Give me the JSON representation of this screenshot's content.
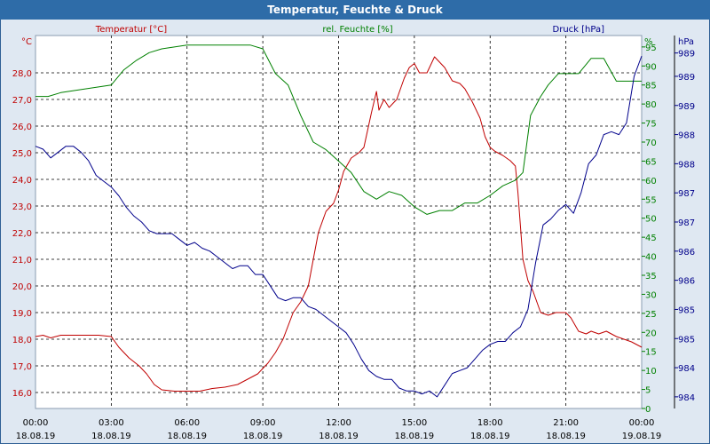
{
  "window": {
    "title": "Temperatur, Feuchte & Druck"
  },
  "chart_data": {
    "type": "line",
    "title": "Temperatur, Feuchte & Druck",
    "x_ticks": [
      {
        "time": "00:00",
        "date": "18.08.19"
      },
      {
        "time": "03:00",
        "date": "18.08.19"
      },
      {
        "time": "06:00",
        "date": "18.08.19"
      },
      {
        "time": "09:00",
        "date": "18.08.19"
      },
      {
        "time": "12:00",
        "date": "18.08.19"
      },
      {
        "time": "15:00",
        "date": "18.08.19"
      },
      {
        "time": "18:00",
        "date": "18.08.19"
      },
      {
        "time": "21:00",
        "date": "18.08.19"
      },
      {
        "time": "00:00",
        "date": "19.08.19"
      }
    ],
    "xlim_hours": [
      0,
      24
    ],
    "grid": true,
    "axes": {
      "temp": {
        "label": "Temperatur [°C]",
        "unit": "°C",
        "color": "#c00000",
        "ylim": [
          15.4,
          29.4
        ],
        "ticks": [
          "16,0",
          "17,0",
          "18,0",
          "19,0",
          "20,0",
          "21,0",
          "22,0",
          "23,0",
          "24,0",
          "25,0",
          "26,0",
          "27,0",
          "28,0"
        ],
        "tick_values": [
          16,
          17,
          18,
          19,
          20,
          21,
          22,
          23,
          24,
          25,
          26,
          27,
          28
        ]
      },
      "humidity": {
        "label": "rel. Feuchte [%]",
        "unit": "%",
        "color": "#008000",
        "ylim": [
          0,
          98
        ],
        "ticks": [
          "0",
          "5",
          "10",
          "15",
          "20",
          "25",
          "30",
          "35",
          "40",
          "45",
          "50",
          "55",
          "60",
          "65",
          "70",
          "75",
          "80",
          "85",
          "90",
          "95"
        ],
        "tick_values": [
          0,
          5,
          10,
          15,
          20,
          25,
          30,
          35,
          40,
          45,
          50,
          55,
          60,
          65,
          70,
          75,
          80,
          85,
          90,
          95
        ]
      },
      "pressure": {
        "label": "Druck [hPa]",
        "unit": "hPa",
        "color": "#00008b",
        "ylim": [
          983.5,
          989.9
        ],
        "ticks": [
          "984",
          "984",
          "985",
          "985",
          "986",
          "986",
          "987",
          "987",
          "988",
          "988",
          "989",
          "989",
          "989"
        ],
        "tick_values": [
          983.7,
          984.2,
          984.7,
          985.2,
          985.7,
          986.2,
          986.7,
          987.2,
          987.7,
          988.2,
          988.7,
          989.2,
          989.6
        ]
      }
    },
    "series": [
      {
        "name": "Temperatur [°C]",
        "axis": "temp",
        "color": "#c00000",
        "x": [
          0,
          0.3,
          0.6,
          1,
          1.5,
          2,
          2.5,
          3,
          3.3,
          3.7,
          4.1,
          4.4,
          4.7,
          5,
          5.5,
          6,
          6.5,
          7,
          7.5,
          8,
          8.4,
          8.8,
          9,
          9.2,
          9.5,
          9.8,
          10.2,
          10.5,
          10.8,
          11,
          11.2,
          11.5,
          11.8,
          12,
          12.2,
          12.5,
          12.8,
          13,
          13.3,
          13.5,
          13.6,
          13.8,
          14,
          14.3,
          14.6,
          14.8,
          15,
          15.2,
          15.5,
          15.8,
          16,
          16.2,
          16.5,
          16.8,
          17,
          17.3,
          17.6,
          17.8,
          18,
          18.2,
          18.5,
          18.8,
          19,
          19.1,
          19.3,
          19.5,
          19.7,
          20,
          20.3,
          20.6,
          21,
          21.2,
          21.5,
          21.8,
          22,
          22.3,
          22.6,
          23,
          23.3,
          23.6,
          24
        ],
        "y": [
          18.1,
          18.15,
          18.05,
          18.15,
          18.15,
          18.15,
          18.15,
          18.1,
          17.7,
          17.3,
          17.0,
          16.7,
          16.3,
          16.1,
          16.05,
          16.05,
          16.05,
          16.15,
          16.2,
          16.3,
          16.5,
          16.7,
          16.9,
          17.1,
          17.5,
          18.0,
          19.0,
          19.4,
          20.0,
          21.0,
          22.0,
          22.8,
          23.1,
          23.6,
          24.3,
          24.8,
          25.0,
          25.2,
          26.5,
          27.3,
          26.6,
          27.0,
          26.7,
          27.0,
          27.8,
          28.2,
          28.35,
          28.0,
          28.0,
          28.6,
          28.4,
          28.2,
          27.7,
          27.6,
          27.4,
          26.9,
          26.3,
          25.6,
          25.2,
          25.05,
          24.9,
          24.7,
          24.5,
          23.5,
          21.0,
          20.2,
          19.8,
          19.0,
          18.9,
          19.0,
          19.0,
          18.8,
          18.3,
          18.2,
          18.3,
          18.2,
          18.3,
          18.1,
          18.0,
          17.9,
          17.7
        ]
      },
      {
        "name": "rel. Feuchte [%]",
        "axis": "humidity",
        "color": "#008000",
        "x": [
          0,
          0.5,
          1,
          1.5,
          2,
          2.5,
          3,
          3.5,
          4,
          4.5,
          5,
          5.5,
          6,
          6.5,
          7,
          7.5,
          8,
          8.5,
          9,
          9.5,
          10,
          10.5,
          11,
          11.5,
          12,
          12.5,
          13,
          13.5,
          14,
          14.5,
          15,
          15.5,
          16,
          16.5,
          17,
          17.5,
          18,
          18.5,
          19,
          19.3,
          19.6,
          20,
          20.3,
          20.7,
          21,
          21.5,
          22,
          22.5,
          23,
          23.5,
          24
        ],
        "y": [
          82,
          82,
          83,
          83.5,
          84,
          84.5,
          85,
          89,
          91.5,
          93.5,
          94.5,
          95,
          95.5,
          95.5,
          95.5,
          95.5,
          95.5,
          95.5,
          94.5,
          88,
          85,
          77,
          70,
          68,
          65,
          62,
          57,
          55,
          57,
          56,
          53,
          51,
          52,
          52,
          54,
          54,
          56,
          58.5,
          60,
          62,
          77,
          82,
          85,
          88,
          88,
          88,
          92,
          92,
          86,
          86,
          86
        ]
      },
      {
        "name": "Druck [hPa]",
        "axis": "pressure",
        "color": "#00008b",
        "x": [
          0,
          0.3,
          0.6,
          0.9,
          1.2,
          1.5,
          1.8,
          2.1,
          2.4,
          2.7,
          3,
          3.3,
          3.6,
          3.9,
          4.2,
          4.5,
          4.8,
          5.1,
          5.4,
          5.7,
          6,
          6.3,
          6.6,
          6.9,
          7.2,
          7.5,
          7.8,
          8.1,
          8.4,
          8.7,
          9,
          9.3,
          9.6,
          9.9,
          10.2,
          10.5,
          10.8,
          11.1,
          11.4,
          11.7,
          12,
          12.3,
          12.6,
          12.9,
          13.2,
          13.5,
          13.8,
          14.1,
          14.4,
          14.7,
          15,
          15.3,
          15.6,
          15.9,
          16.2,
          16.5,
          16.8,
          17.1,
          17.4,
          17.7,
          18,
          18.3,
          18.6,
          18.9,
          19.2,
          19.5,
          19.8,
          20.1,
          20.4,
          20.7,
          21,
          21.3,
          21.6,
          21.9,
          22.2,
          22.5,
          22.8,
          23.1,
          23.4,
          23.7,
          24
        ],
        "y": [
          988.0,
          987.95,
          987.8,
          987.9,
          988.0,
          988.0,
          987.9,
          987.75,
          987.5,
          987.4,
          987.3,
          987.15,
          986.95,
          986.8,
          986.7,
          986.55,
          986.5,
          986.5,
          986.5,
          986.4,
          986.3,
          986.35,
          986.25,
          986.2,
          986.1,
          986.0,
          985.9,
          985.95,
          985.95,
          985.8,
          985.8,
          985.6,
          985.4,
          985.35,
          985.4,
          985.4,
          985.25,
          985.2,
          985.1,
          985.0,
          984.9,
          984.8,
          984.6,
          984.35,
          984.15,
          984.05,
          984.0,
          984.0,
          983.85,
          983.8,
          983.8,
          983.75,
          983.8,
          983.7,
          983.9,
          984.1,
          984.15,
          984.2,
          984.35,
          984.5,
          984.6,
          984.65,
          984.65,
          984.8,
          984.9,
          985.2,
          986.0,
          986.65,
          986.75,
          986.9,
          987.0,
          986.85,
          987.2,
          987.7,
          987.85,
          988.2,
          988.25,
          988.2,
          988.4,
          989.2,
          989.55
        ]
      }
    ]
  }
}
